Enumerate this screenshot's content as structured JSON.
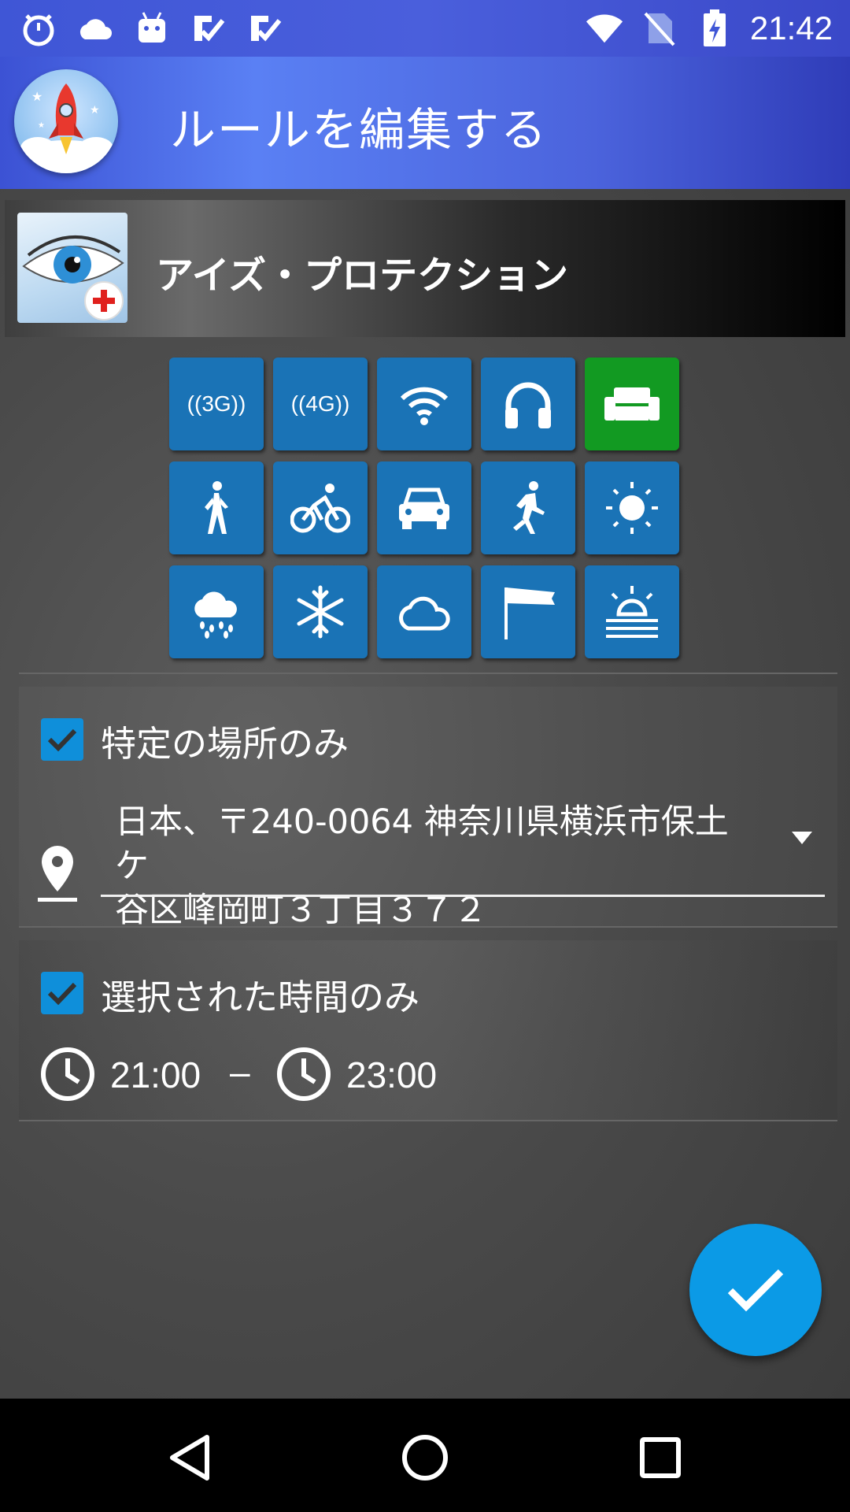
{
  "status_bar": {
    "time": "21:42",
    "left_icons": [
      "alarm-icon",
      "cloud-icon",
      "android-icon",
      "check-list-icon",
      "check-list-icon"
    ],
    "right_icons": [
      "wifi-icon",
      "no-sim-icon",
      "battery-charging-icon"
    ]
  },
  "app_bar": {
    "title": "ルールを編集する",
    "logo": "rocket-logo"
  },
  "selected_app": {
    "name": "アイズ・プロテクション",
    "icon": "eye-protection-icon"
  },
  "condition_grid": [
    {
      "icon": "3g-icon",
      "label": "3G",
      "active": false
    },
    {
      "icon": "4g-icon",
      "label": "4G",
      "active": false
    },
    {
      "icon": "wifi-icon",
      "active": false
    },
    {
      "icon": "headphones-icon",
      "active": false
    },
    {
      "icon": "sofa-icon",
      "active": true
    },
    {
      "icon": "walking-icon",
      "active": false
    },
    {
      "icon": "bicycle-icon",
      "active": false
    },
    {
      "icon": "car-icon",
      "active": false
    },
    {
      "icon": "running-icon",
      "active": false
    },
    {
      "icon": "sun-icon",
      "active": false
    },
    {
      "icon": "rain-icon",
      "active": false
    },
    {
      "icon": "snowflake-icon",
      "active": false
    },
    {
      "icon": "cloud-icon",
      "active": false
    },
    {
      "icon": "windsock-icon",
      "active": false
    },
    {
      "icon": "fog-icon",
      "active": false
    }
  ],
  "location": {
    "checkbox_label": "特定の場所のみ",
    "checked": true,
    "address_line1": "日本、〒240-0064 神奈川県横浜市保土ケ",
    "address_line2": "谷区峰岡町３丁目３７２"
  },
  "time": {
    "checkbox_label": "選択された時間のみ",
    "checked": true,
    "start": "21:00",
    "separator": "–",
    "end": "23:00"
  },
  "colors": {
    "accent": "#0b9ae6",
    "tile": "#1a73b6",
    "tile_active": "#129a22",
    "app_bar": "#4b63dc"
  }
}
